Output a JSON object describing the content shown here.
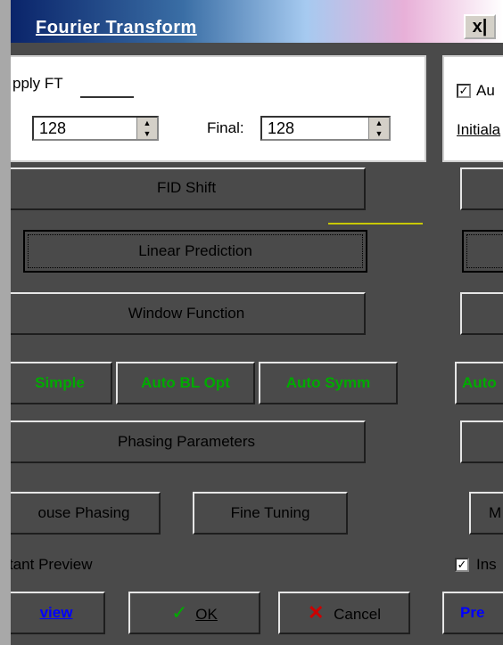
{
  "window": {
    "title": "Fourier Transform",
    "close_label": "x|"
  },
  "apply_ft": {
    "label": "pply FT"
  },
  "spin_initial": {
    "value": "128"
  },
  "final": {
    "label": "Final:",
    "value": "128"
  },
  "right_panel": {
    "auto_label": "Au",
    "initial_label": "Initiala"
  },
  "buttons": {
    "fid_shift": "FID Shift",
    "linear_prediction": "Linear Prediction",
    "window_function": "Window Function",
    "phasing_parameters": "Phasing Parameters",
    "mouse_phasing": "ouse Phasing",
    "fine_tuning": "Fine Tuning",
    "right_m": "M",
    "ok": "OK",
    "cancel": "Cancel",
    "preview": "view",
    "right_preview": "Pre"
  },
  "baseline": {
    "simple": "Simple",
    "auto_bl_opt": "Auto BL Opt",
    "auto_symm": "Auto Symm",
    "right_auto": "Auto"
  },
  "instant_preview": {
    "label": "tant Preview"
  },
  "right_instant": {
    "label": "Ins"
  },
  "colors": {
    "title_start": "#0a246a",
    "green_text": "#00aa00",
    "blue_text": "#0000ff",
    "cancel_x": "#cc0000",
    "ok_check": "#00aa00"
  }
}
